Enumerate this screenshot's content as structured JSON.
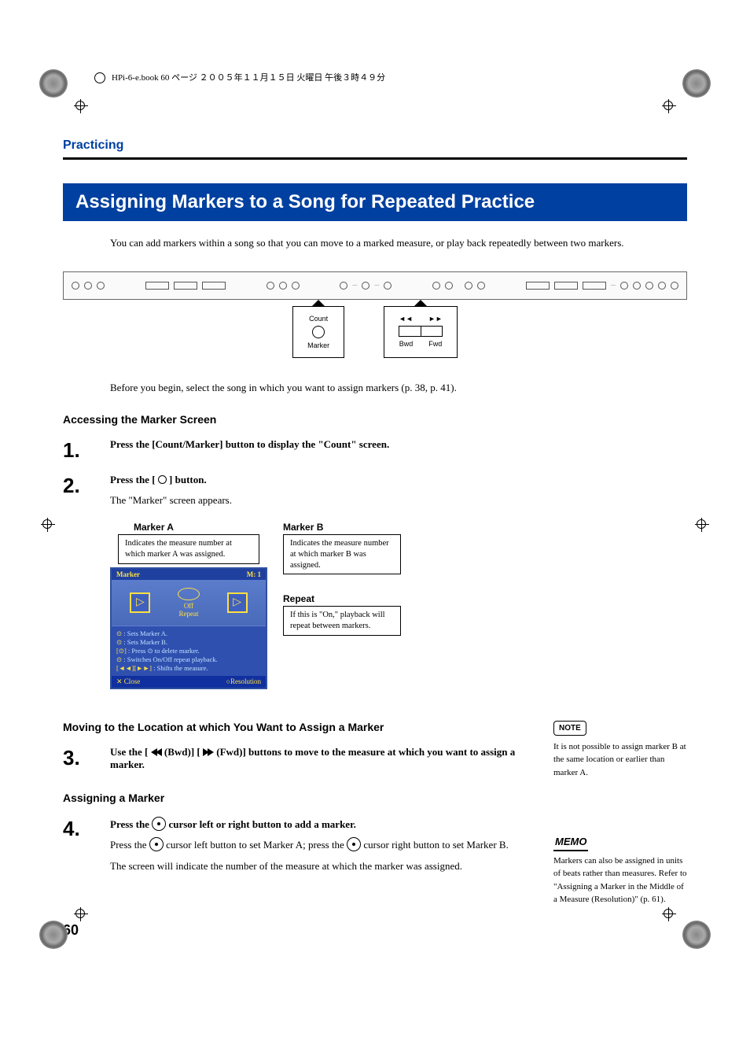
{
  "header": "HPi-6-e.book 60 ページ ２００５年１１月１５日 火曜日 午後３時４９分",
  "section_title": "Practicing",
  "banner": "Assigning Markers to a Song for Repeated Practice",
  "intro": "You can add markers within a song so that you can move to a marked measure, or play back repeatedly between two markers.",
  "callout_left": {
    "top": "Count",
    "bottom": "Marker"
  },
  "callout_right": {
    "l": "◄◄",
    "r": "►►",
    "bl": "Bwd",
    "br": "Fwd"
  },
  "before": "Before you begin, select the song in which you want to assign markers (p. 38, p. 41).",
  "sub1": "Accessing the Marker Screen",
  "step1": "Press the [Count/Marker] button to display the \"Count\" screen.",
  "step2": {
    "line": "Press the [",
    "line2": "] button.",
    "after": "The \"Marker\" screen appears."
  },
  "markerA": {
    "title": "Marker A",
    "desc": "Indicates the measure number at which marker A was assigned."
  },
  "lcd": {
    "title": "Marker",
    "meas": "M: 1",
    "off": "Off",
    "repeat": "Repeat",
    "h1": ": Sets Marker A.",
    "h2": ": Sets Marker B.",
    "h3": ": Press ⊙ to delete marker.",
    "h4": ": Switches On/Off repeat playback.",
    "h5": ": Shifts the measure.",
    "close": "✕ Close",
    "res": "○Resolution"
  },
  "markerB": {
    "title": "Marker B",
    "desc": "Indicates the measure number at which marker B was assigned."
  },
  "repeat": {
    "title": "Repeat",
    "desc": "If this is \"On,\" playback will repeat between markers."
  },
  "sub2": "Moving to the Location at which You Want to Assign a Marker",
  "step3": {
    "p1": "Use the [",
    "p2": " (Bwd)] [",
    "p3": " (Fwd)] buttons to move to the measure at which you want to assign a marker."
  },
  "note_label": "NOTE",
  "note_text": "It is not possible to assign marker B at the same location or earlier than marker A.",
  "sub3": "Assigning a Marker",
  "step4": {
    "p1": "Press the ",
    "p2": " cursor left or right button to add a marker.",
    "l1a": "Press the ",
    "l1b": " cursor left button to set Marker A; press the ",
    "l1c": " cursor right button to set Marker B.",
    "l2": "The screen will indicate the number of the measure at which the marker was assigned."
  },
  "memo_label": "MEMO",
  "memo_text": "Markers can also be assigned in units of beats rather than measures. Refer to \"Assigning a Marker in the Middle of a Measure (Resolution)\" (p. 61).",
  "page_num": "60"
}
